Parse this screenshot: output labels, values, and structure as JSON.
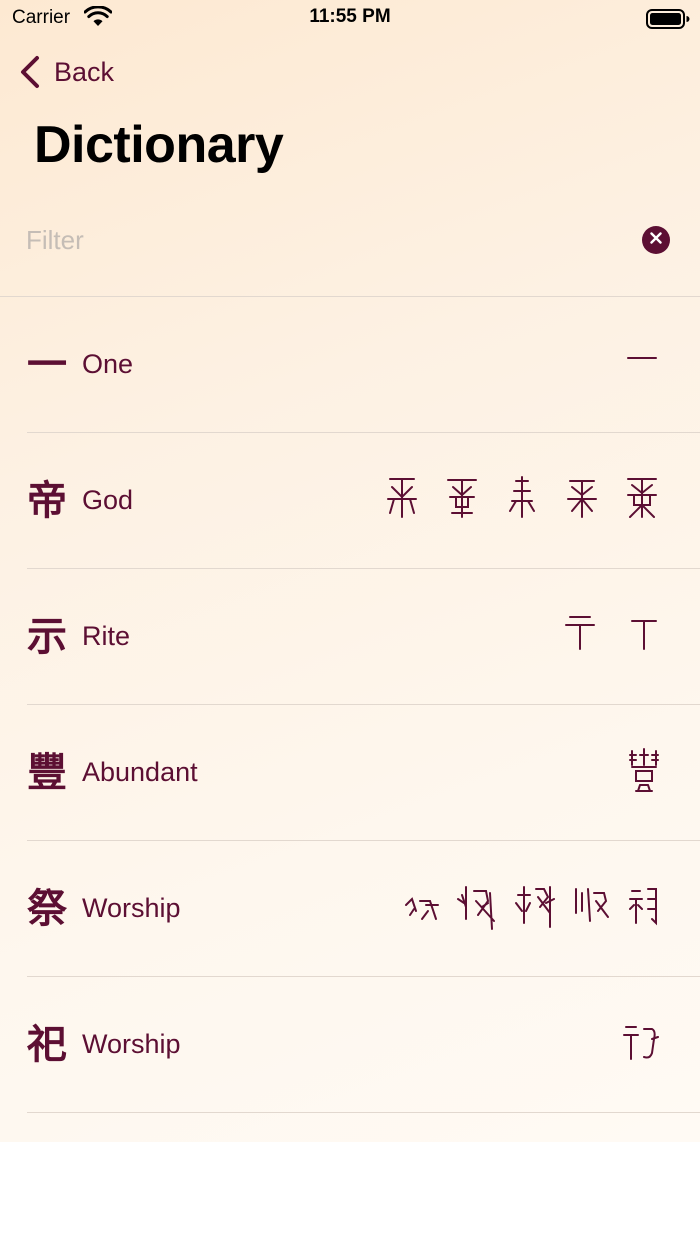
{
  "status_bar": {
    "carrier": "Carrier",
    "time": "11:55 PM"
  },
  "nav": {
    "back_label": "Back",
    "title": "Dictionary"
  },
  "filter": {
    "placeholder": "Filter",
    "value": ""
  },
  "colors": {
    "accent": "#5c0f33",
    "divider": "#e2d8cf",
    "placeholder": "#c5bdb6"
  },
  "entries": [
    {
      "character": "一",
      "meaning": "One",
      "oracle_glyph_count": 1
    },
    {
      "character": "帝",
      "meaning": "God",
      "oracle_glyph_count": 5
    },
    {
      "character": "示",
      "meaning": "Rite",
      "oracle_glyph_count": 2
    },
    {
      "character": "豐",
      "meaning": "Abundant",
      "oracle_glyph_count": 1
    },
    {
      "character": "祭",
      "meaning": "Worship",
      "oracle_glyph_count": 5
    },
    {
      "character": "祀",
      "meaning": "Worship",
      "oracle_glyph_count": 1
    }
  ]
}
